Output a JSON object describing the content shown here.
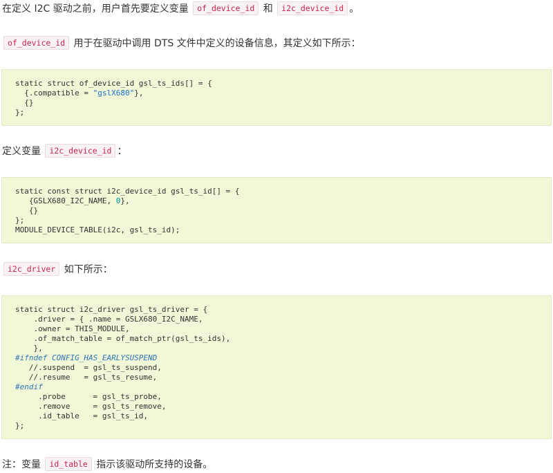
{
  "p1": {
    "text_a": "在定义 I2C 驱动之前，用户首先要定义变量",
    "code_a": "of_device_id",
    "text_b": "和",
    "code_b": "i2c_device_id",
    "text_c": "。"
  },
  "p2": {
    "code": "of_device_id",
    "text": "用于在驱动中调用 DTS 文件中定义的设备信息，其定义如下所示："
  },
  "code1": {
    "l1": "static struct of_device_id gsl_ts_ids[] = {",
    "l2_a": "  {.compatible = ",
    "l2_str": "\"gslX680\"",
    "l2_b": "},",
    "l3": "  {}",
    "l4": "};"
  },
  "p3": {
    "text_a": "定义变量",
    "code": "i2c_device_id",
    "text_b": "："
  },
  "code2": {
    "l1": "static const struct i2c_device_id gsl_ts_id[] = {",
    "l2_a": "   {GSLX680_I2C_NAME, ",
    "l2_num": "0",
    "l2_b": "},",
    "l3": "   {}",
    "l4": "};",
    "l5": "MODULE_DEVICE_TABLE(i2c, gsl_ts_id);"
  },
  "p4": {
    "code": "i2c_driver",
    "text": "如下所示："
  },
  "code3": {
    "l1": "static struct i2c_driver gsl_ts_driver = {",
    "l2": "    .driver = { .name = GSLX680_I2C_NAME,",
    "l3": "    .owner = THIS_MODULE,",
    "l4": "    .of_match_table = of_match_ptr(gsl_ts_ids),",
    "l5": "    },",
    "l6": "#ifndef CONFIG_HAS_EARLYSUSPEND",
    "l7": "   //.suspend  = gsl_ts_suspend,",
    "l8": "   //.resume   = gsl_ts_resume,",
    "l9": "#endif",
    "l10": "     .probe      = gsl_ts_probe,",
    "l11": "     .remove     = gsl_ts_remove,",
    "l12": "     .id_table   = gsl_ts_id,",
    "l13": "};"
  },
  "p5": {
    "text_a": "注：变量",
    "code": "id_table",
    "text_b": "指示该驱动所支持的设备。"
  }
}
